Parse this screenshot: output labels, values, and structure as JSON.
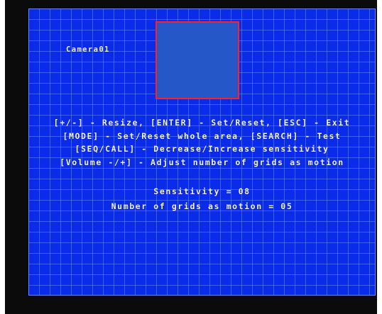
{
  "camera": {
    "label": "Camera01"
  },
  "instructions": [
    "[+/-] - Resize, [ENTER] - Set/Reset, [ESC] - Exit",
    "[MODE] - Set/Reset whole area, [SEARCH] - Test",
    "[SEQ/CALL] - Decrease/Increase sensitivity",
    "[Volume -/+] - Adjust number of grids as motion"
  ],
  "status": {
    "sensitivity": "Sensitivity = 08",
    "grids_as_motion": "Number of grids as motion = 05"
  },
  "colors": {
    "background_blue": "#0a2be8",
    "grid_line": "#78a0ff",
    "selection_border": "#ff2020",
    "selection_fill": "#2657c9",
    "text": "#f2f2f2"
  }
}
